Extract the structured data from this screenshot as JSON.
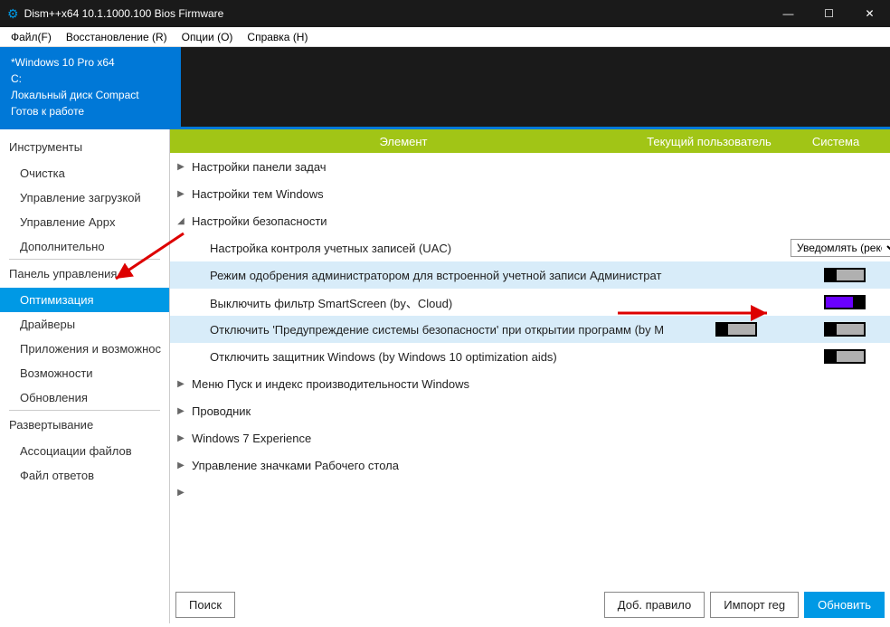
{
  "titlebar": {
    "app_icon": "⚙",
    "title": "Dism++x64 10.1.1000.100 Bios Firmware"
  },
  "menubar": {
    "file": "Файл(F)",
    "recovery": "Восстановление (R)",
    "options": "Опции (O)",
    "help": "Справка (H)"
  },
  "info": {
    "os": "*Windows 10 Pro x64",
    "drive": "C:",
    "disk": "Локальный диск Compact",
    "status": "Готов к работе"
  },
  "sidebar": {
    "g_tools": "Инструменты",
    "cleanup": "Очистка",
    "boot": "Управление загрузкой",
    "appx": "Управление Appx",
    "extra": "Дополнительно",
    "g_cp": "Панель управления",
    "optimize": "Оптимизация",
    "drivers": "Драйверы",
    "apps": "Приложения и возможнос",
    "features": "Возможности",
    "updates": "Обновления",
    "g_deploy": "Развертывание",
    "assoc": "Ассоциации файлов",
    "answer": "Файл ответов"
  },
  "columns": {
    "element": "Элемент",
    "user": "Текущий пользователь",
    "system": "Система"
  },
  "rows": {
    "taskbar": "Настройки панели задач",
    "themes": "Настройки тем Windows",
    "security": "Настройки безопасности",
    "uac": "Настройка контроля учетных записей (UAC)",
    "uac_combo": "Уведомлять (реком",
    "admin_mode": "Режим одобрения администратором для встроенной учетной записи Администрат",
    "smartscreen": "Выключить фильтр SmartScreen (by、Cloud)",
    "sec_warn": "Отключить 'Предупреждение системы безопасности' при открытии программ (by M",
    "defender": "Отключить защитник Windows (by Windows 10 optimization aids)",
    "startmenu": "Меню Пуск и индекс производительности Windows",
    "explorer": "Проводник",
    "win7exp": "Windows 7 Experience",
    "desktop_icons": "Управление значками Рабочего стола"
  },
  "buttons": {
    "search": "Поиск",
    "add_rule": "Доб. правило",
    "import_reg": "Импорт reg",
    "refresh": "Обновить"
  }
}
